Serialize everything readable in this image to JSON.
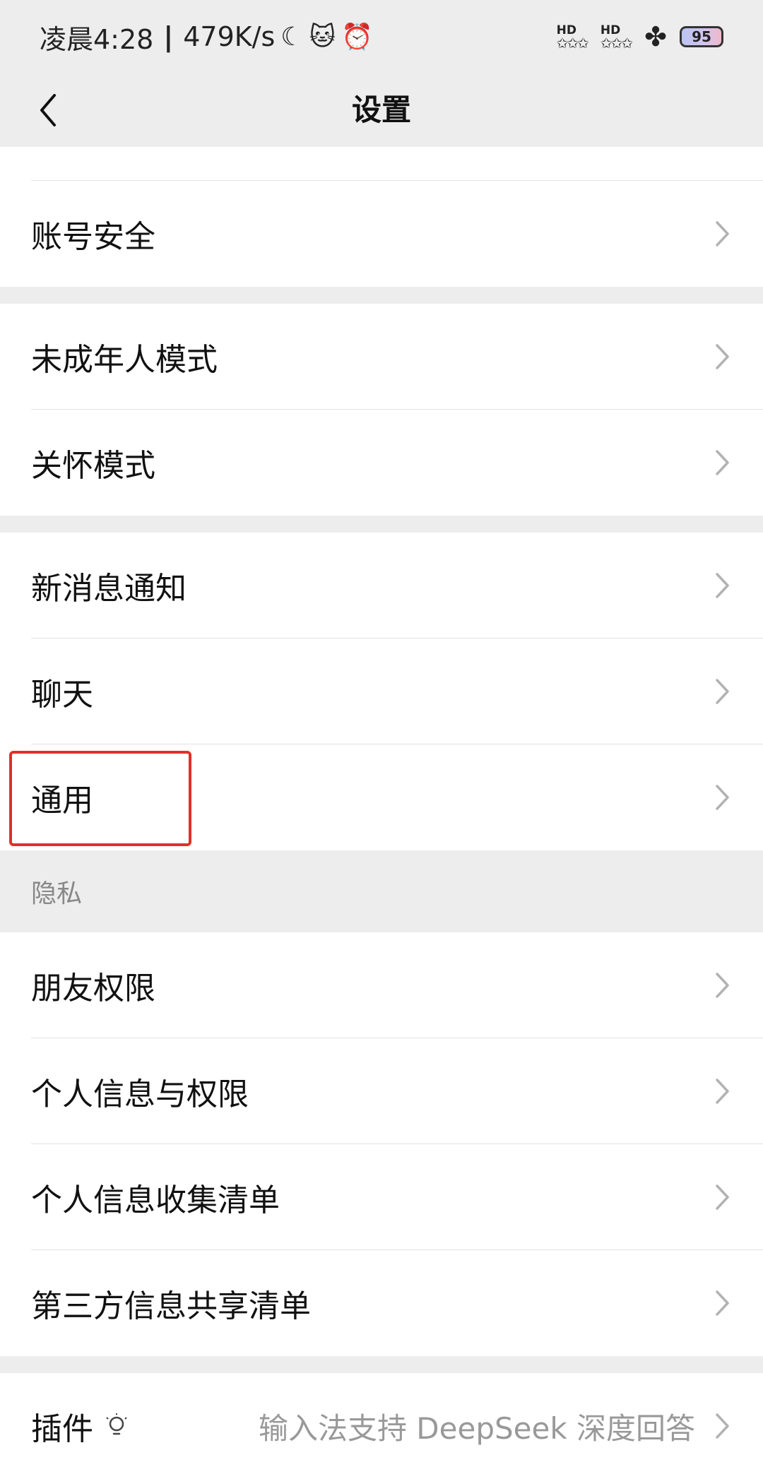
{
  "status_bar": {
    "time": "凌晨4:28",
    "separator": "|",
    "speed": "479K/s",
    "moon_icon": "☾",
    "cat_icon": "🐱",
    "alarm_icon": "⏰",
    "sim1": "HD",
    "sim2": "HD",
    "stars": "✩✩✩",
    "clover_icon": "✤",
    "battery": "95"
  },
  "header": {
    "title": "设置"
  },
  "groups": {
    "account": {
      "security": "账号安全"
    },
    "modes": {
      "minor": "未成年人模式",
      "care": "关怀模式"
    },
    "general": {
      "notifications": "新消息通知",
      "chat": "聊天",
      "general": "通用"
    },
    "privacy": {
      "section_title": "隐私",
      "friend_permissions": "朋友权限",
      "personal_info": "个人信息与权限",
      "info_collection": "个人信息收集清单",
      "third_party": "第三方信息共享清单"
    },
    "plugins": {
      "label": "插件",
      "value": "输入法支持 DeepSeek 深度回答"
    }
  },
  "colors": {
    "highlight": "#e0302a",
    "background": "#ededed"
  }
}
